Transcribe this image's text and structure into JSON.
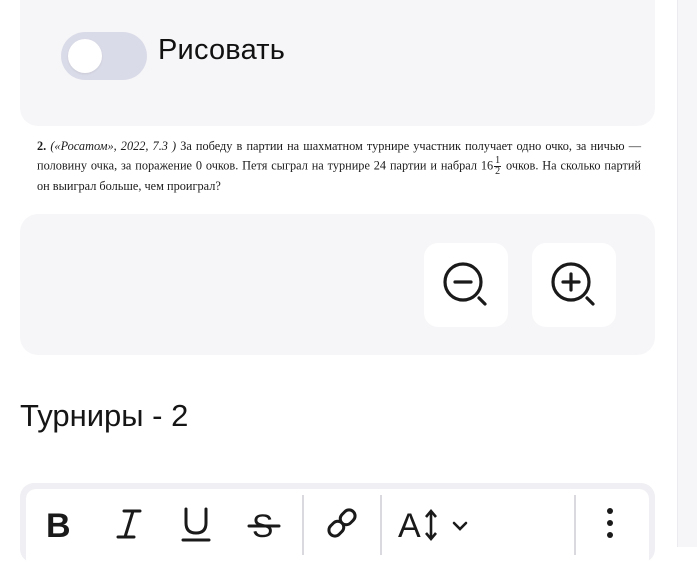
{
  "draw_toggle": {
    "label": "Рисовать",
    "on": false
  },
  "problem": {
    "number": "2.",
    "source": "(«Росатом», 2022, 7.3 )",
    "text_before": " За победу в партии на шахматном турнире участник получает одно очко, за ничью — половину очка, за поражение 0 очков. Петя сыграл на турнире 24 партии и набрал 16",
    "fraction_num": "1",
    "fraction_den": "2",
    "text_after": " очков. На сколько партий он выиграл больше, чем проиграл?"
  },
  "zoom": {
    "out_icon": "zoom-out-icon",
    "in_icon": "zoom-in-icon"
  },
  "section": {
    "title": "Турниры - 2"
  },
  "toolbar": {
    "buttons": [
      "bold-icon",
      "italic-icon",
      "underline-icon",
      "strikethrough-icon",
      "link-icon",
      "text-size-icon",
      "more-vertical-icon"
    ]
  },
  "colors": {
    "panel": "#f6f6f8",
    "toggle_off": "#dadbe8",
    "icon": "#1a1a1a"
  }
}
